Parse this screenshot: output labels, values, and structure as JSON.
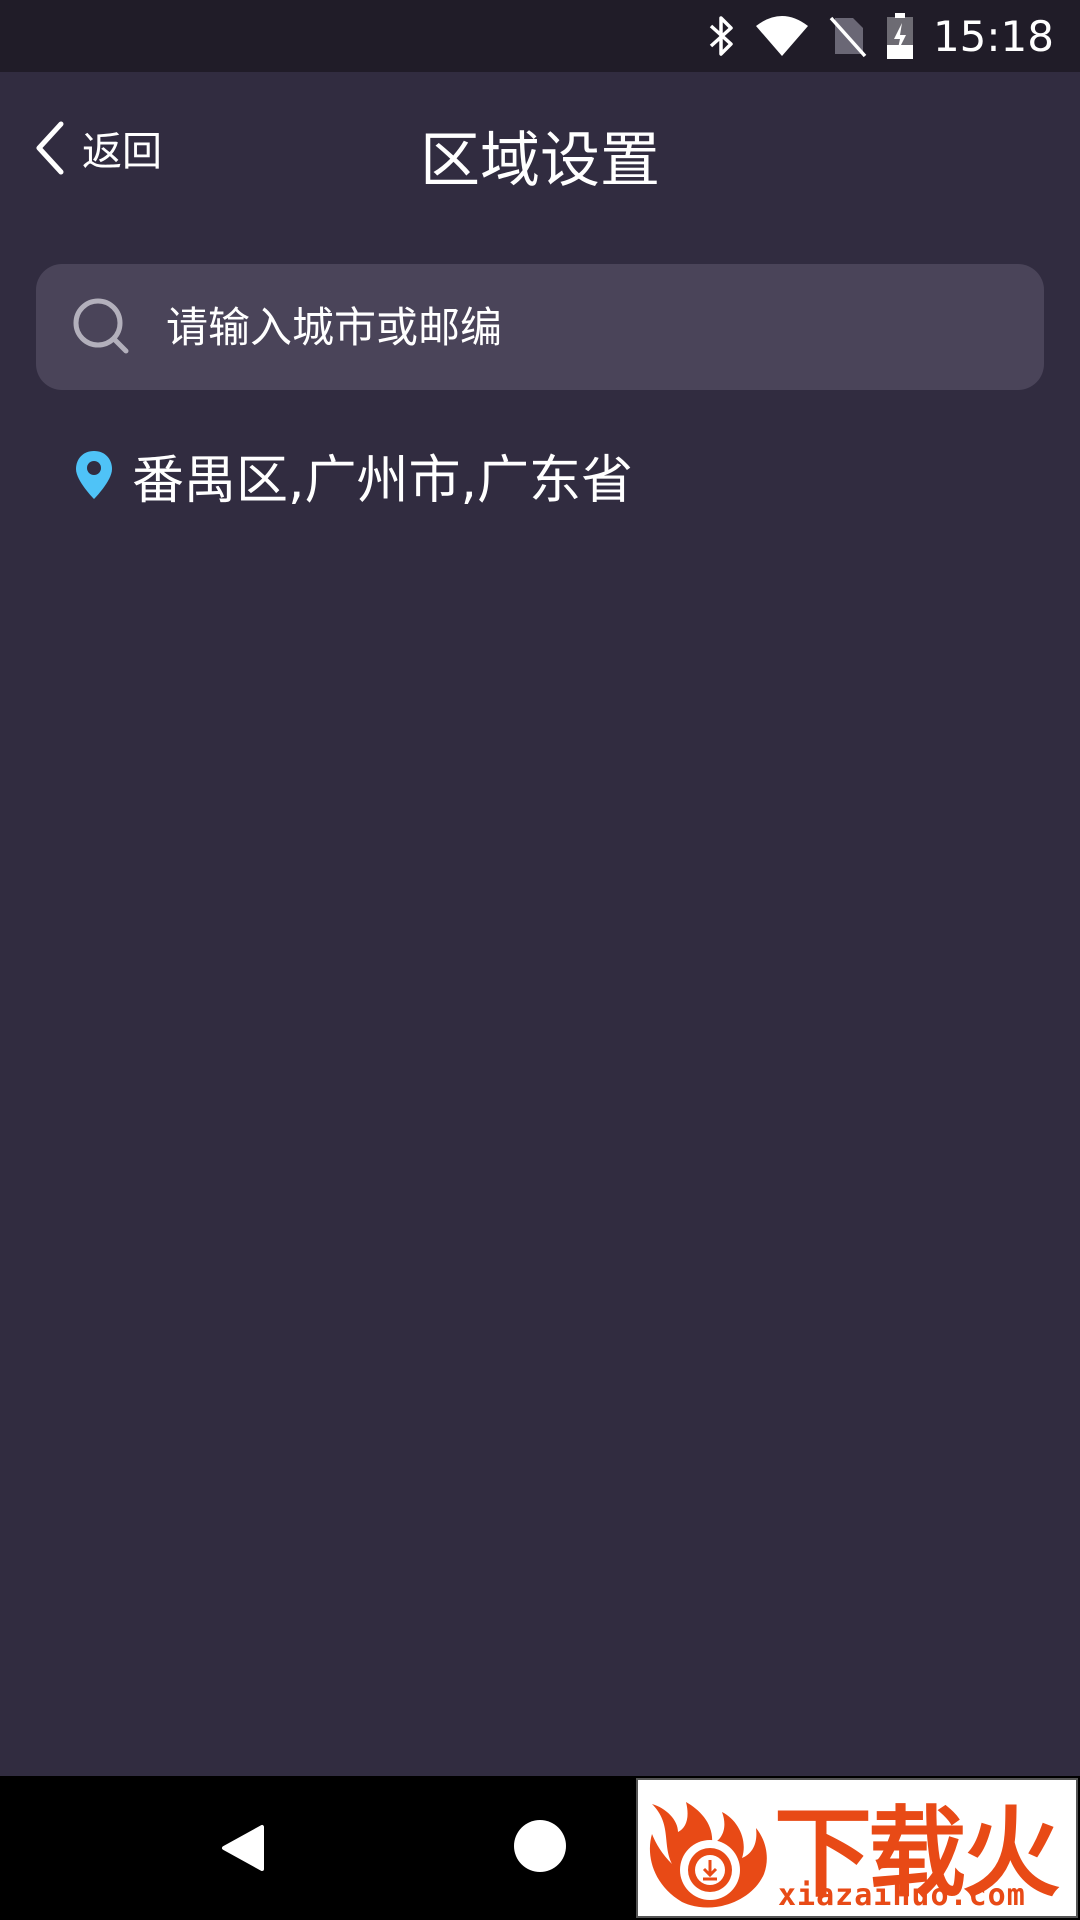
{
  "status_bar": {
    "time": "15:18",
    "icons": [
      "bluetooth-icon",
      "wifi-icon",
      "no-sim-icon",
      "battery-charging-icon"
    ]
  },
  "header": {
    "back_label": "返回",
    "title": "区域设置"
  },
  "search": {
    "placeholder": "请输入城市或邮编",
    "value": ""
  },
  "current_location": {
    "text": "番禺区,广州市,广东省"
  },
  "watermark": {
    "brand": "下载火",
    "url": "xiazaihuo.com"
  },
  "colors": {
    "background": "#312c40",
    "status_bar": "#201c28",
    "search_box": "#4a4459",
    "pin": "#4fc3f7",
    "watermark_accent": "#e84a16"
  }
}
